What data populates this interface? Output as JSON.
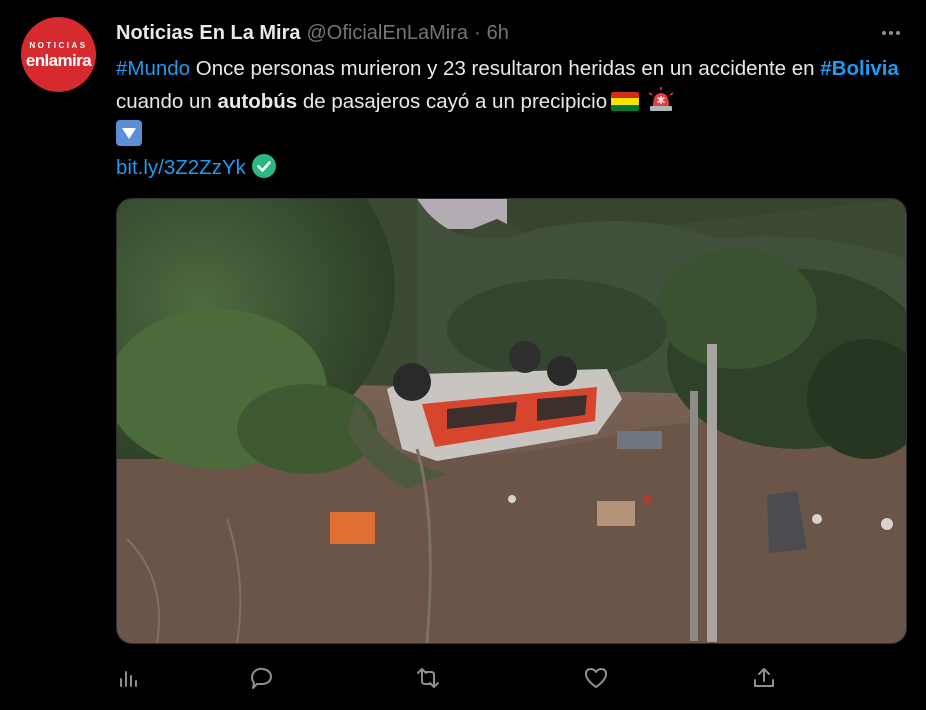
{
  "author": {
    "avatar_line1": "NOTICIAS",
    "avatar_line2": "enlamira",
    "name": "Noticias En La Mira",
    "handle": "@OficialEnLaMira",
    "separator": "·",
    "time": "6h"
  },
  "tweet": {
    "hashtag1": "#Mundo",
    "text1": " Once personas murieron y 23 resultaron heridas en un accidente en ",
    "hashtag2": "#Bolivia",
    "text2": " cuando un ",
    "bold_word": "autobús",
    "text3": " de pasajeros cayó a un precipicio",
    "link": "bit.ly/3Z2ZzYk"
  },
  "icons": {
    "more": "more-icon",
    "flag": "bolivia-flag-icon",
    "siren": "siren-icon",
    "down": "down-arrow-button-icon",
    "check": "check-mark-icon",
    "analytics": "analytics-icon",
    "reply": "reply-icon",
    "retweet": "retweet-icon",
    "like": "like-icon",
    "share": "share-icon"
  },
  "colors": {
    "background": "#000000",
    "text": "#e7e9ea",
    "muted": "#71767b",
    "link": "#1d9bf0",
    "avatar": "#d62a2f"
  }
}
